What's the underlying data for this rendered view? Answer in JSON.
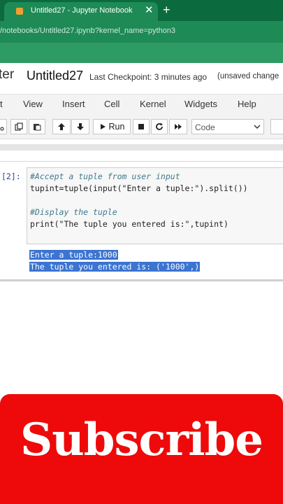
{
  "browser": {
    "tab_title": "Untitled27 - Jupyter Notebook",
    "tab_close": "✕",
    "new_tab": "+",
    "url": "/notebooks/Untitled27.ipynb?kernel_name=python3"
  },
  "header": {
    "logo": "ter",
    "notebook_name": "Untitled27",
    "checkpoint": "Last Checkpoint: 3 minutes ago",
    "status": "(unsaved change"
  },
  "menu": [
    "t",
    "View",
    "Insert",
    "Cell",
    "Kernel",
    "Widgets",
    "Help"
  ],
  "toolbar": {
    "run_label": "Run",
    "cell_type": "Code"
  },
  "cell": {
    "prompt": "[2]:",
    "code": [
      "#Accept a tuple from user input",
      "tupint=tuple(input(\"Enter a tuple:\").split())",
      "",
      "#Display the tuple",
      "print(\"The tuple you entered is:\",tupint)"
    ],
    "output": [
      "Enter a tuple:1000",
      "The tuple you entered is: ('1000',)"
    ]
  },
  "banner": {
    "text": "Subscribe",
    "color": "#ee0a0a"
  },
  "colors": {
    "chrome": "#0b6b3f",
    "selection": "#3b74d1"
  }
}
